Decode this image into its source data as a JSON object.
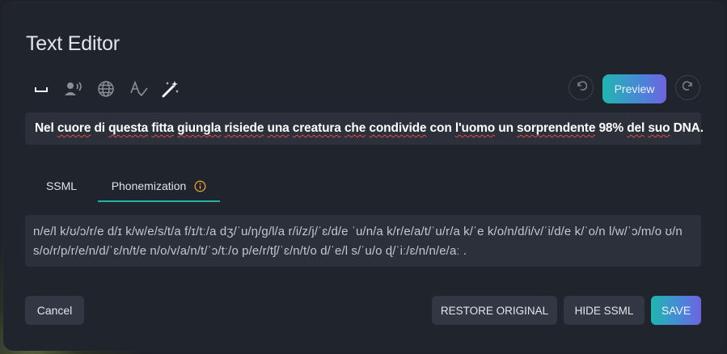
{
  "dialog": {
    "title": "Text Editor"
  },
  "toolbar": {
    "icons": [
      "pause-icon",
      "voice-icon",
      "globe-icon",
      "spellcheck-icon",
      "magic-wand-icon"
    ],
    "undo_icon": "undo-icon",
    "redo_icon": "redo-icon",
    "preview_label": "Preview"
  },
  "editor": {
    "text_segments": [
      {
        "t": "Nel ",
        "err": false
      },
      {
        "t": "cuore",
        "err": true
      },
      {
        "t": " di ",
        "err": false
      },
      {
        "t": "questa",
        "err": true
      },
      {
        "t": " ",
        "err": false
      },
      {
        "t": "fitta",
        "err": true
      },
      {
        "t": " ",
        "err": false
      },
      {
        "t": "giungla",
        "err": true
      },
      {
        "t": " ",
        "err": false
      },
      {
        "t": "risiede",
        "err": true
      },
      {
        "t": " ",
        "err": false
      },
      {
        "t": "una",
        "err": true
      },
      {
        "t": " ",
        "err": false
      },
      {
        "t": "creatura",
        "err": true
      },
      {
        "t": " ",
        "err": false
      },
      {
        "t": "che",
        "err": true
      },
      {
        "t": " ",
        "err": false
      },
      {
        "t": "condivide",
        "err": true
      },
      {
        "t": " con ",
        "err": false
      },
      {
        "t": "l'uomo",
        "err": true
      },
      {
        "t": " un ",
        "err": false
      },
      {
        "t": "sorprendente",
        "err": true
      },
      {
        "t": " 98% ",
        "err": false
      },
      {
        "t": "del",
        "err": true
      },
      {
        "t": " ",
        "err": false
      },
      {
        "t": "suo",
        "err": true
      },
      {
        "t": " DNA.",
        "err": false
      }
    ]
  },
  "tabs": [
    {
      "label": "SSML",
      "active": false
    },
    {
      "label": "Phonemization",
      "active": true,
      "icon": "info-icon"
    }
  ],
  "phonemization": {
    "line1": "n/e/l k/ʊ/ɔ/r/e d/ɪ k/w/e/s/t/a f/ɪ/tː/a dʒ/ˈu/ŋ/g/l/a r/i/z/j/ˈɛ/d/e ˈu/n/a k/r/e/a/t/ˈu/r/a k/ˈe k/o/n/d/i/v/ˈi/d/e k/ˈo/n l/w/ˈɔ/m/o ʊ/n",
    "line2": "s/o/r/p/r/e/n/d/ˈɛ/n/t/e n/o/v/a/n/t/ˈɔ/tː/o p/e/r/tʃ/ˈɛ/n/t/o d/ˈe/l s/ˈu/o ɖ/ˈiː/ɛ/n/n/e/aː ."
  },
  "footer": {
    "cancel_label": "Cancel",
    "restore_label": "RESTORE ORIGINAL",
    "hide_ssml_label": "HIDE SSML",
    "save_label": "SAVE"
  },
  "colors": {
    "accent_teal": "#20b2aa",
    "accent_purple": "#6e63e0",
    "info_orange": "#e8a13a",
    "spell_error": "#e34a4a"
  }
}
